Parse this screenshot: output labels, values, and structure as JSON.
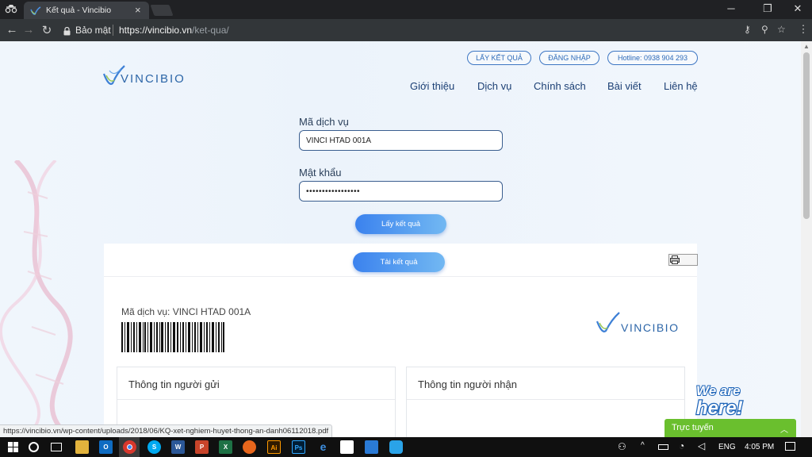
{
  "browser": {
    "tab_title": "Kết quả - Vincibio",
    "secure_label": "Bảo mật",
    "url_host": "https://vincibio.vn",
    "url_path": "/ket-qua/"
  },
  "header": {
    "logo_text": "VINCIBIO",
    "pills": {
      "results": "LẤY KẾT QUẢ",
      "login": "ĐĂNG NHẬP",
      "hotline": "Hotline: 0938 904 293"
    },
    "nav": [
      "Giới thiệu",
      "Dịch vụ",
      "Chính sách",
      "Bài viết",
      "Liên hệ"
    ]
  },
  "form": {
    "service_code_label": "Mã dịch vụ",
    "service_code_value": "VINCI HTAD 001A",
    "password_label": "Mật khẩu",
    "password_value": "•••••••••••••••••",
    "submit_label": "Lấy kết quả"
  },
  "result": {
    "download_label": "Tải kết quả",
    "service_line": "Mã dịch vụ: VINCI HTAD 001A",
    "logo_text": "VINCIBIO",
    "sender_title": "Thông tin người gửi",
    "receiver_title": "Thông tin người nhận"
  },
  "chat": {
    "title": "Trực tuyến"
  },
  "status_url": "https://vincibio.vn/wp-content/uploads/2018/06/KQ-xet-nghiem-huyet-thong-an-danh06112018.pdf",
  "taskbar": {
    "language": "ENG",
    "time": "4:05 PM"
  },
  "colors": {
    "brand_blue": "#2d66a8",
    "chat_green": "#6abf2e"
  }
}
